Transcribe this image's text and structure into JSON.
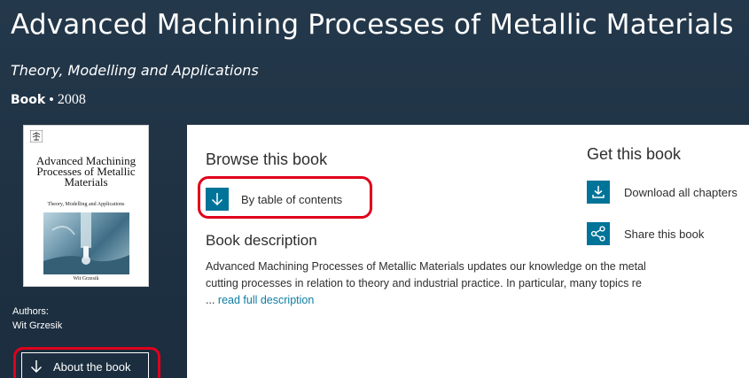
{
  "book": {
    "title": "Advanced Machining Processes of Metallic Materials",
    "subtitle": "Theory, Modelling and Applications",
    "type": "Book",
    "separator": "•",
    "year": "2008"
  },
  "cover": {
    "title": "Advanced Machining Processes of Metallic Materials",
    "subtitle": "Theory, Modelling and Applications",
    "author": "Wit Grzesik"
  },
  "sidebar": {
    "authors_label": "Authors:",
    "author_name": "Wit Grzesik",
    "about_button": "About the book"
  },
  "browse": {
    "title": "Browse this book",
    "toc_button": "By table of contents"
  },
  "description": {
    "title": "Book description",
    "text": "Advanced Machining Processes of Metallic Materials updates our knowledge on the metal cutting processes in relation to theory and industrial practice. In particular, many topics re ... ",
    "read_more": "read full description"
  },
  "get_book": {
    "title": "Get this book",
    "download": "Download all chapters",
    "share": "Share this book"
  },
  "colors": {
    "accent": "#007398",
    "link": "#0c7da3",
    "highlight": "#e0001b",
    "header_bg": "#1f3345"
  }
}
